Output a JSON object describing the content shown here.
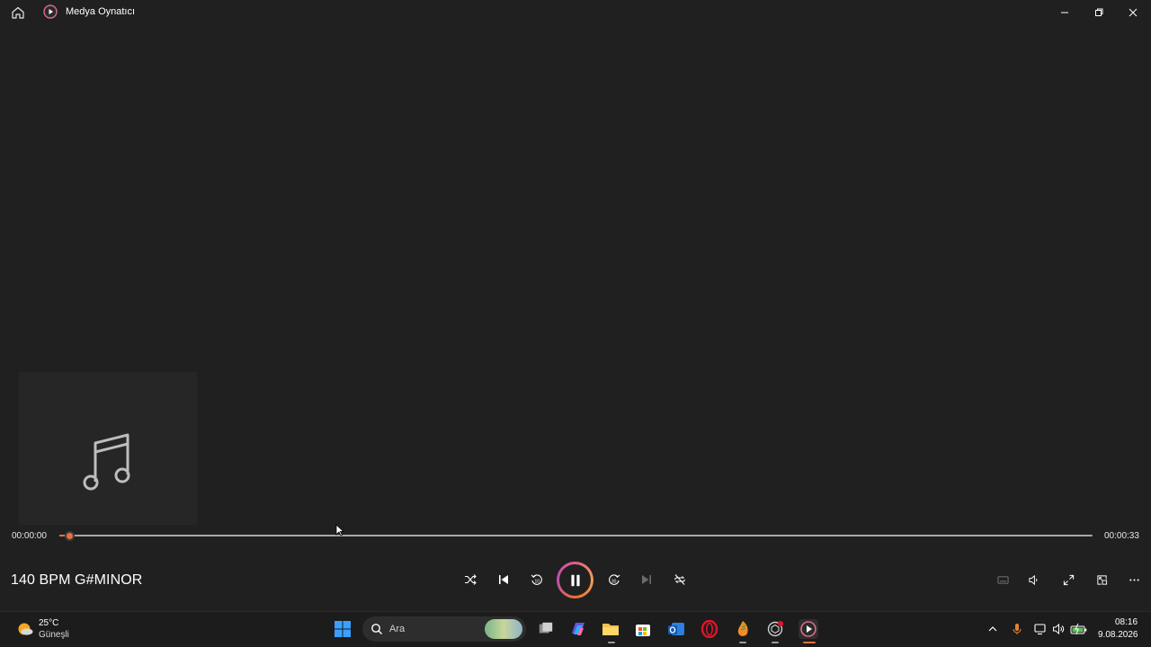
{
  "window": {
    "title": "Medya Oynatıcı"
  },
  "player": {
    "elapsed": "00:00:00",
    "duration": "00:00:33",
    "progress_fraction": 0.01,
    "track_title": "140 BPM G#MINOR",
    "state": "playing"
  },
  "taskbar": {
    "weather_temp": "25°C",
    "weather_desc": "Güneşli",
    "search_placeholder": "Ara",
    "time": "08:16",
    "date": "9.08.2026"
  },
  "colors": {
    "background": "#202020",
    "accent": "#e8703a",
    "taskbar": "#1c1c1c"
  },
  "icons": {
    "controls": [
      "shuffle-icon",
      "previous-icon",
      "rewind-10-icon",
      "pause-icon",
      "forward-30-icon",
      "next-icon",
      "repeat-off-icon"
    ],
    "right_controls": [
      "captions-icon",
      "volume-icon",
      "fullscreen-icon",
      "mini-player-icon",
      "more-icon"
    ]
  }
}
